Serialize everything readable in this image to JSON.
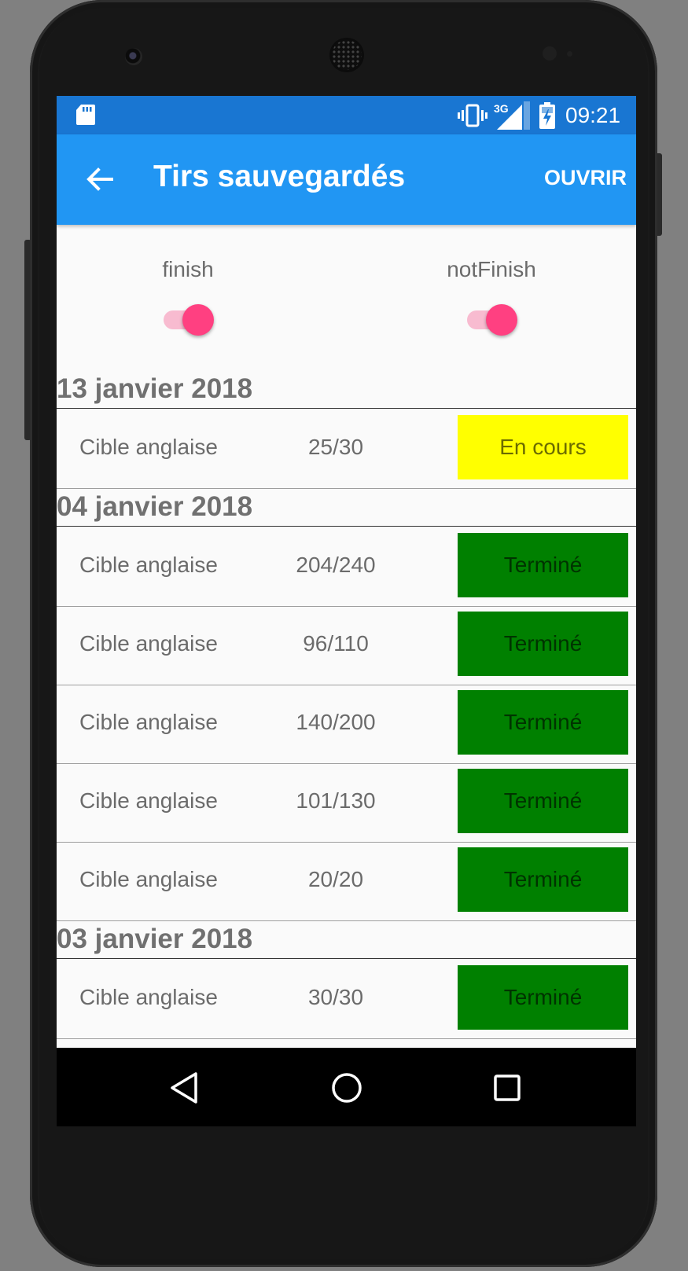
{
  "status_bar": {
    "time": "09:21",
    "network": "3G",
    "icons": [
      "sd-card-icon",
      "vibrate-icon",
      "signal-icon",
      "battery-charging-icon"
    ]
  },
  "app_bar": {
    "title": "Tirs sauvegardés",
    "action": "OUVRIR",
    "back_icon": "arrow-back-icon"
  },
  "filters": [
    {
      "label": "finish",
      "on": true
    },
    {
      "label": "notFinish",
      "on": true
    }
  ],
  "sections": [
    {
      "date": "13 janvier 2018",
      "rows": [
        {
          "target": "Cible anglaise",
          "score": "25/30",
          "status": "En cours",
          "kind": "in_progress"
        }
      ]
    },
    {
      "date": "04 janvier 2018",
      "rows": [
        {
          "target": "Cible anglaise",
          "score": "204/240",
          "status": "Terminé",
          "kind": "done"
        },
        {
          "target": "Cible anglaise",
          "score": "96/110",
          "status": "Terminé",
          "kind": "done"
        },
        {
          "target": "Cible anglaise",
          "score": "140/200",
          "status": "Terminé",
          "kind": "done"
        },
        {
          "target": "Cible anglaise",
          "score": "101/130",
          "status": "Terminé",
          "kind": "done"
        },
        {
          "target": "Cible anglaise",
          "score": "20/20",
          "status": "Terminé",
          "kind": "done"
        }
      ]
    },
    {
      "date": "03 janvier 2018",
      "rows": [
        {
          "target": "Cible anglaise",
          "score": "30/30",
          "status": "Terminé",
          "kind": "done"
        }
      ]
    }
  ],
  "colors": {
    "status_bar": "#1976d2",
    "app_bar": "#2196f3",
    "in_progress": "#ffff00",
    "in_progress_text": "#6b6b00",
    "done": "#008000",
    "done_text": "#003300",
    "switch_thumb": "#ff4081",
    "switch_track": "#f8bbd0"
  },
  "nav_bar": {
    "icons": [
      "nav-back-icon",
      "nav-home-icon",
      "nav-recents-icon"
    ]
  }
}
